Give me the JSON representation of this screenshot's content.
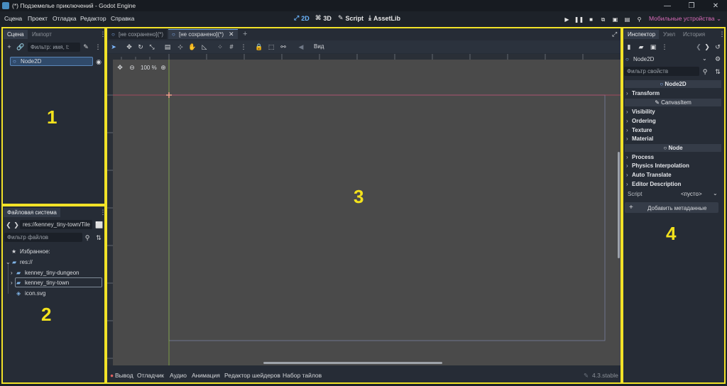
{
  "window": {
    "title": "(*) Подземелье приключений - Godot Engine"
  },
  "menu": {
    "items": [
      "Сцена",
      "Проект",
      "Отладка",
      "Редактор",
      "Справка"
    ]
  },
  "main_screens": {
    "d2": "2D",
    "d3": "3D",
    "script": "Script",
    "assetlib": "AssetLib"
  },
  "renderer": {
    "label": "Мобильные устройства"
  },
  "scene_dock": {
    "tabs": [
      "Сцена",
      "Импорт"
    ],
    "filter_placeholder": "Фильтр: имя, t:",
    "root_node": "Node2D"
  },
  "filesystem_dock": {
    "tab": "Файловая система",
    "path": "res://kenney_tiny-town/Tile",
    "filter_placeholder": "Фильтр файлов",
    "favorites": "Избранное:",
    "root": "res://",
    "folders": [
      "kenney_tiny-dungeon",
      "kenney_tiny-town"
    ],
    "files": [
      "icon.svg"
    ]
  },
  "viewport": {
    "tabs": [
      "[не сохранено](*)",
      "[не сохранено](*)"
    ],
    "zoom": "100 %",
    "view_menu": "Вид"
  },
  "inspector": {
    "tabs": [
      "Инспектор",
      "Узел",
      "История"
    ],
    "node": "Node2D",
    "filter_placeholder": "Фильтр свойств",
    "headers": {
      "node2d": "Node2D",
      "canvasitem": "CanvasItem",
      "node": "Node"
    },
    "node2d_sections": [
      "Transform"
    ],
    "canvasitem_sections": [
      "Visibility",
      "Ordering",
      "Texture",
      "Material"
    ],
    "node_sections": [
      "Process",
      "Physics Interpolation",
      "Auto Translate",
      "Editor Description"
    ],
    "script_label": "Script",
    "script_value": "<пусто>",
    "add_metadata": "Добавить метаданные"
  },
  "bottom_panel": {
    "tabs": [
      "Вывод",
      "Отладчик",
      "Аудио",
      "Анимация",
      "Редактор шейдеров",
      "Набор тайлов"
    ],
    "version": "4.3.stable"
  },
  "annotations": {
    "n1": "1",
    "n2": "2",
    "n3": "3",
    "n4": "4"
  },
  "colors": {
    "accent": "#478cbf",
    "highlight": "#f2e228",
    "renderer": "#d86ab8"
  }
}
